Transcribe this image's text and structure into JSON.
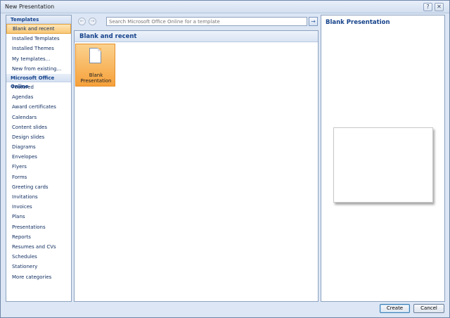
{
  "window": {
    "title": "New Presentation",
    "help_glyph": "?",
    "close_glyph": "✕"
  },
  "sidebar": {
    "templates_header": "Templates",
    "templates_items": [
      {
        "label": "Blank and recent",
        "selected": true
      },
      {
        "label": "Installed Templates"
      },
      {
        "label": "Installed Themes"
      },
      {
        "label": "My templates..."
      },
      {
        "label": "New from existing..."
      }
    ],
    "online_header": "Microsoft Office Online",
    "online_items": [
      "Featured",
      "Agendas",
      "Award certificates",
      "Calendars",
      "Content slides",
      "Design slides",
      "Diagrams",
      "Envelopes",
      "Flyers",
      "Forms",
      "Greeting cards",
      "Invitations",
      "Invoices",
      "Plans",
      "Presentations",
      "Reports",
      "Resumes and CVs",
      "Schedules",
      "Stationery",
      "More categories"
    ]
  },
  "center": {
    "back_glyph": "←",
    "forward_glyph": "→",
    "search_placeholder": "Search Microsoft Office Online for a template",
    "go_glyph": "→",
    "header": "Blank and recent",
    "tile_label": "Blank Presentation"
  },
  "preview": {
    "title": "Blank Presentation"
  },
  "footer": {
    "create": "Create",
    "cancel": "Cancel"
  },
  "colors": {
    "accent": "#15428b",
    "selection": "#f9c876"
  }
}
